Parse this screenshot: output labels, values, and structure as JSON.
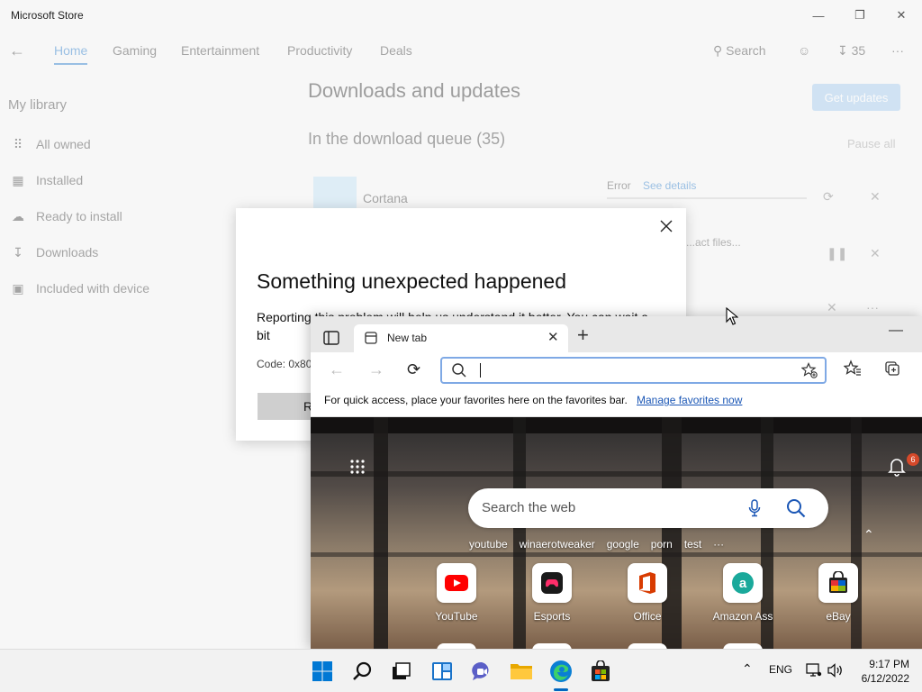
{
  "store": {
    "title": "Microsoft Store",
    "nav": {
      "tabs": [
        "Home",
        "Gaming",
        "Entertainment",
        "Productivity",
        "Deals"
      ],
      "search_label": "Search",
      "downloads_count": "35",
      "more": "···"
    },
    "library": {
      "title": "My library",
      "items": [
        "All owned",
        "Installed",
        "Ready to install",
        "Downloads",
        "Included with device"
      ]
    },
    "downloads": {
      "heading": "Downloads and updates",
      "get_updates": "Get updates",
      "queue_heading": "In the download queue (35)",
      "pause_all": "Pause all",
      "item_name": "Cortana",
      "error_label": "Error",
      "see_details": "See details",
      "fetch_label": "...act files..."
    }
  },
  "dialog": {
    "title": "Something unexpected happened",
    "text": "Reporting this problem will help us understand it better. You can wait a bit",
    "code": "Code: 0x80",
    "button": "Re"
  },
  "edge": {
    "tab_title": "New tab",
    "fav_bar_text": "For quick access, place your favorites here on the favorites bar.",
    "fav_bar_link": "Manage favorites now",
    "web_search_placeholder": "Search the web",
    "notification_count": "6",
    "quick_links": [
      "youtube",
      "winaerotweaker",
      "google",
      "porn",
      "test",
      "···"
    ],
    "tiles": [
      {
        "label": "YouTube",
        "icon": "youtube-icon"
      },
      {
        "label": "Esports",
        "icon": "esports-icon"
      },
      {
        "label": "Office",
        "icon": "office-icon"
      },
      {
        "label": "Amazon Ass",
        "icon": "amazon-assistant-icon"
      },
      {
        "label": "eBay",
        "icon": "ebay-icon"
      }
    ]
  },
  "taskbar": {
    "language": "ENG",
    "time": "9:17 PM",
    "date": "6/12/2022"
  },
  "colors": {
    "accent": "#1a73c9",
    "link": "#1a56b5",
    "badge": "#d6492a"
  }
}
